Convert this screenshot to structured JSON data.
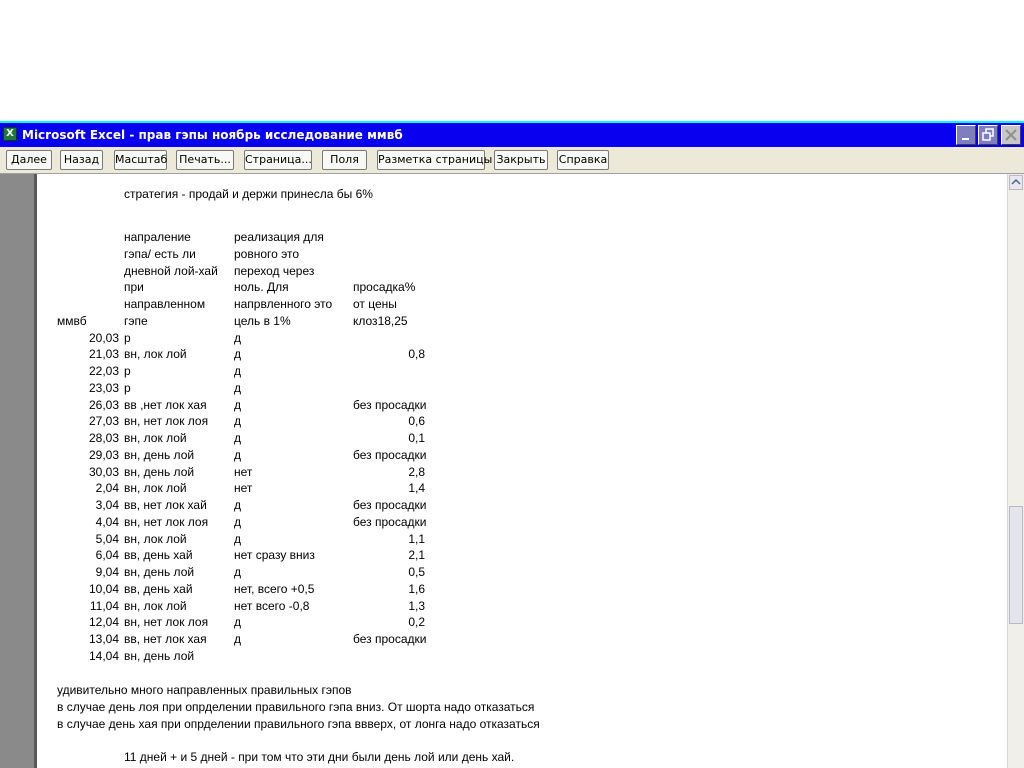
{
  "window": {
    "title": "Microsoft Excel - прав гэпы ноябрь исследование ммвб",
    "app_icon": "excel-icon",
    "app_icon_glyph": "X",
    "controls": [
      "minimize-icon",
      "restore-icon",
      "close-icon"
    ]
  },
  "toolbar": {
    "next": "Далее",
    "prev": "Назад",
    "zoom": "Масштаб",
    "print": "Печать...",
    "setup": "Страница...",
    "margins": "Поля",
    "page_break": "Разметка страницы",
    "close": "Закрыть",
    "help": "Справка"
  },
  "sheet": {
    "strategy_note": "стратегия - продай и держи принесла бы 6%",
    "header": {
      "col_a": "ммвб",
      "col_b": [
        "напраление",
        "гэпа/ есть ли",
        "дневной лой-хай",
        "при",
        "направленном",
        "гэпе"
      ],
      "col_c": [
        "реализация для",
        "ровного это",
        "переход через",
        "ноль. Для",
        "напрвленного это",
        "цель в 1%"
      ],
      "col_d": [
        "просадка%",
        "от цены",
        "клоз18,25"
      ]
    },
    "rows": [
      {
        "date": "20,03",
        "gap": "р",
        "realization": "д",
        "drawdown": ""
      },
      {
        "date": "21,03",
        "gap": "вн, лок лой",
        "realization": "д",
        "drawdown": "0,8"
      },
      {
        "date": "22,03",
        "gap": "р",
        "realization": "д",
        "drawdown": ""
      },
      {
        "date": "23,03",
        "gap": "р",
        "realization": "д",
        "drawdown": ""
      },
      {
        "date": "26,03",
        "gap": "вв ,нет лок хая",
        "realization": "д",
        "drawdown": "без просадки"
      },
      {
        "date": "27,03",
        "gap": "вн, нет лок лоя",
        "realization": "д",
        "drawdown": "0,6"
      },
      {
        "date": "28,03",
        "gap": "вн, лок лой",
        "realization": "д",
        "drawdown": "0,1"
      },
      {
        "date": "29,03",
        "gap": "вн, день лой",
        "realization": "д",
        "drawdown": "без просадки"
      },
      {
        "date": "30,03",
        "gap": "вн, день лой",
        "realization": "нет",
        "drawdown": "2,8"
      },
      {
        "date": "2,04",
        "gap": "вн, лок лой",
        "realization": "нет",
        "drawdown": "1,4"
      },
      {
        "date": "3,04",
        "gap": "вв, нет лок хай",
        "realization": "д",
        "drawdown": "без просадки"
      },
      {
        "date": "4,04",
        "gap": "вн, нет лок лоя",
        "realization": "д",
        "drawdown": "без просадки"
      },
      {
        "date": "5,04",
        "gap": "вн, лок лой",
        "realization": "д",
        "drawdown": "1,1"
      },
      {
        "date": "6,04",
        "gap": "вв, день хай",
        "realization": "нет сразу вниз",
        "drawdown": "2,1"
      },
      {
        "date": "9,04",
        "gap": "вн, день лой",
        "realization": "д",
        "drawdown": "0,5"
      },
      {
        "date": "10,04",
        "gap": "вв, день хай",
        "realization": "нет, всего +0,5",
        "drawdown": "1,6"
      },
      {
        "date": "11,04",
        "gap": "вн, лок лой",
        "realization": "нет всего -0,8",
        "drawdown": "1,3"
      },
      {
        "date": "12,04",
        "gap": "вн, нет лок лоя",
        "realization": "д",
        "drawdown": "0,2"
      },
      {
        "date": "13,04",
        "gap": "вв,  нет лок хая",
        "realization": "д",
        "drawdown": "без просадки"
      },
      {
        "date": "14,04",
        "gap": "вн, день лой",
        "realization": "",
        "drawdown": ""
      }
    ],
    "notes": [
      "удивительно много направленных правильных гэпов",
      "в случае день лоя при опрделении правильного гэпа вниз. От шорта надо отказаться",
      "в случае день хая при опрделении правильного гэпа ввверх, от лонга надо отказаться"
    ],
    "summary": "11 дней + и 5 дней - при том что эти дни были день лой или день хай."
  }
}
